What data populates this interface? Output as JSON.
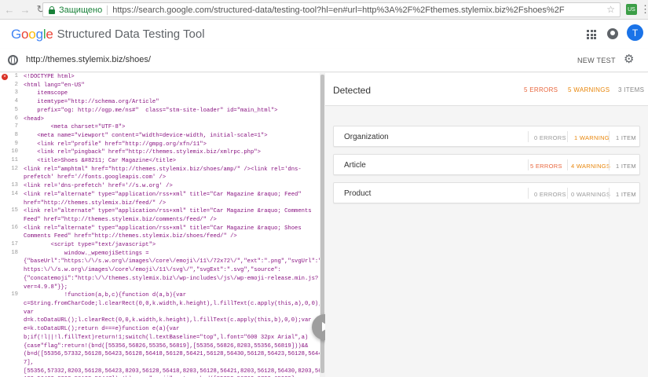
{
  "browser": {
    "secure_label": "Защищено",
    "url": "https://search.google.com/structured-data/testing-tool?hl=en#url=http%3A%2F%2Fthemes.stylemix.biz%2Fshoes%2F"
  },
  "header": {
    "logo": "Google",
    "title": "Structured Data Testing Tool",
    "avatar_letter": "T"
  },
  "toolbar": {
    "tested_url": "http://themes.stylemix.biz/shoes/",
    "new_test_label": "NEW TEST"
  },
  "code_lines": [
    {
      "n": "1",
      "text": "<!DOCTYPE html>",
      "error": true
    },
    {
      "n": "2",
      "text": "<html lang=\"en-US\""
    },
    {
      "n": "3",
      "text": "    itemscope"
    },
    {
      "n": "4",
      "text": "    itemtype=\"http://schema.org/Article\""
    },
    {
      "n": "5",
      "text": "    prefix=\"og: http://ogp.me/ns#\"  class=\"stm-site-loader\" id=\"main_html\">"
    },
    {
      "n": "6",
      "text": "<head>"
    },
    {
      "n": "7",
      "text": "        <meta charset=\"UTF-8\">"
    },
    {
      "n": "8",
      "text": "    <meta name=\"viewport\" content=\"width=device-width, initial-scale=1\">"
    },
    {
      "n": "9",
      "text": "    <link rel=\"profile\" href=\"http://gmpg.org/xfn/11\">"
    },
    {
      "n": "10",
      "text": "    <link rel=\"pingback\" href=\"http://themes.stylemix.biz/xmlrpc.php\">"
    },
    {
      "n": "11",
      "text": "    <title>Shoes &#8211; Car Magazine</title>"
    },
    {
      "n": "12",
      "text": "<link rel=\"amphtml\" href=\"http://themes.stylemix.biz/shoes/amp/\" /><link rel='dns-"
    },
    {
      "n": "",
      "text": "prefetch' href='//fonts.googleapis.com' />"
    },
    {
      "n": "13",
      "text": "<link rel='dns-prefetch' href='//s.w.org' />"
    },
    {
      "n": "14",
      "text": "<link rel=\"alternate\" type=\"application/rss+xml\" title=\"Car Magazine &raquo; Feed\""
    },
    {
      "n": "",
      "text": "href=\"http://themes.stylemix.biz/feed/\" />"
    },
    {
      "n": "15",
      "text": "<link rel=\"alternate\" type=\"application/rss+xml\" title=\"Car Magazine &raquo; Comments"
    },
    {
      "n": "",
      "text": "Feed\" href=\"http://themes.stylemix.biz/comments/feed/\" />"
    },
    {
      "n": "16",
      "text": "<link rel=\"alternate\" type=\"application/rss+xml\" title=\"Car Magazine &raquo; Shoes"
    },
    {
      "n": "",
      "text": "Comments Feed\" href=\"http://themes.stylemix.biz/shoes/feed/\" />"
    },
    {
      "n": "17",
      "text": "        <script type=\"text/javascript\">"
    },
    {
      "n": "18",
      "text": "            window._wpemojiSettings ="
    },
    {
      "n": "",
      "text": "{\"baseUrl\":\"https:\\/\\/s.w.org\\/images\\/core\\/emoji\\/11\\/72x72\\/\",\"ext\":\".png\",\"svgUrl\":\""
    },
    {
      "n": "",
      "text": "https:\\/\\/s.w.org\\/images\\/core\\/emoji\\/11\\/svg\\/\",\"svgExt\":\".svg\",\"source\":"
    },
    {
      "n": "",
      "text": "{\"concatemoji\":\"http:\\/\\/themes.stylemix.biz\\/wp-includes\\/js\\/wp-emoji-release.min.js?"
    },
    {
      "n": "",
      "text": "ver=4.9.8\"}};"
    },
    {
      "n": "19",
      "text": "            !function(a,b,c){function d(a,b){var"
    },
    {
      "n": "",
      "text": "c=String.fromCharCode;l.clearRect(0,0,k.width,k.height),l.fillText(c.apply(this,a),0,0);"
    },
    {
      "n": "",
      "text": "var"
    },
    {
      "n": "",
      "text": "d=k.toDataURL();l.clearRect(0,0,k.width,k.height),l.fillText(c.apply(this,b),0,0);var"
    },
    {
      "n": "",
      "text": "e=k.toDataURL();return d===e}function e(a){var"
    },
    {
      "n": "",
      "text": "b;if(!l||!l.fillText)return!1;switch(l.textBaseline=\"top\",l.font=\"600 32px Arial\",a)"
    },
    {
      "n": "",
      "text": "{case\"flag\":return!(b=d([55356,56826,55356,56819],[55356,56826,8203,55356,56819]))&&"
    },
    {
      "n": "",
      "text": "(b=d([55356,57332,56128,56423,56128,56418,56128,56421,56128,56430,56128,56423,56128,5644"
    },
    {
      "n": "",
      "text": "7],"
    },
    {
      "n": "",
      "text": "[55356,57332,8203,56128,56423,8203,56128,56418,8203,56128,56421,8203,56128,56430,8203,56"
    },
    {
      "n": "",
      "text": "128,56423,8203,56128,56447]),!b);case\"emoji\":return b=d([55358,56760,9792,65039],"
    }
  ],
  "results": {
    "heading": "Detected",
    "errors": "5 ERRORS",
    "warnings": "5 WARNINGS",
    "items": "3 ITEMS",
    "cards": [
      {
        "title": "Organization",
        "errors": "0 ERRORS",
        "warnings": "1 WARNING",
        "items": "1 ITEM"
      },
      {
        "title": "Article",
        "errors": "5 ERRORS",
        "warnings": "4 WARNINGS",
        "items": "1 ITEM"
      },
      {
        "title": "Product",
        "errors": "0 ERRORS",
        "warnings": "0 WARNINGS",
        "items": "1 ITEM"
      }
    ]
  },
  "colors": {
    "error": "#e8663d",
    "warning": "#e8860b",
    "accent": "#1a73e8",
    "secure": "#188038"
  }
}
